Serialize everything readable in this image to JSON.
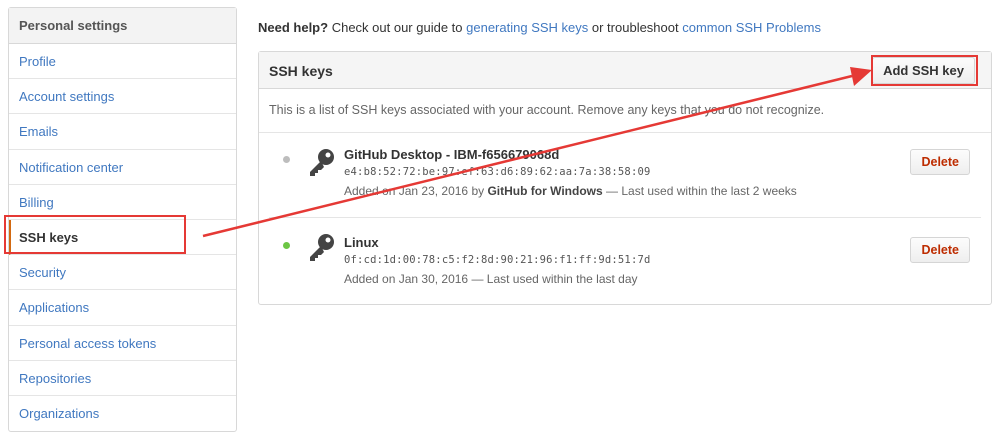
{
  "sidebar": {
    "header": "Personal settings",
    "items": [
      {
        "label": "Profile"
      },
      {
        "label": "Account settings"
      },
      {
        "label": "Emails"
      },
      {
        "label": "Notification center"
      },
      {
        "label": "Billing"
      },
      {
        "label": "SSH keys",
        "active": true
      },
      {
        "label": "Security"
      },
      {
        "label": "Applications"
      },
      {
        "label": "Personal access tokens"
      },
      {
        "label": "Repositories"
      },
      {
        "label": "Organizations"
      }
    ]
  },
  "help": {
    "bold": "Need help?",
    "text1": "Check out our guide to",
    "link1": "generating SSH keys",
    "text2": "or troubleshoot",
    "link2": "common SSH Problems"
  },
  "panel": {
    "title": "SSH keys",
    "add_button": "Add SSH key",
    "description": "This is a list of SSH keys associated with your account. Remove any keys that you do not recognize."
  },
  "keys": [
    {
      "title": "GitHub Desktop - IBM-f656679068d",
      "fingerprint": "e4:b8:52:72:be:97:ef:63:d6:89:62:aa:7a:38:58:09",
      "added_prefix": "Added on Jan 23, 2016 by",
      "added_by": "GitHub for Windows",
      "added_suffix": "— Last used within the last 2 weeks",
      "status_color": "#bdbdbd",
      "delete_label": "Delete"
    },
    {
      "title": "Linux",
      "fingerprint": "0f:cd:1d:00:78:c5:f2:8d:90:21:96:f1:ff:9d:51:7d",
      "added_prefix": "Added on Jan 30, 2016 — Last used within the last day",
      "added_by": "",
      "added_suffix": "",
      "status_color": "#6cc644",
      "delete_label": "Delete"
    }
  ],
  "colors": {
    "link": "#4078c0",
    "annotation_red": "#e53935",
    "delete_red": "#bd2c00"
  },
  "icons": {
    "key": "key-icon",
    "status": "status-dot"
  }
}
